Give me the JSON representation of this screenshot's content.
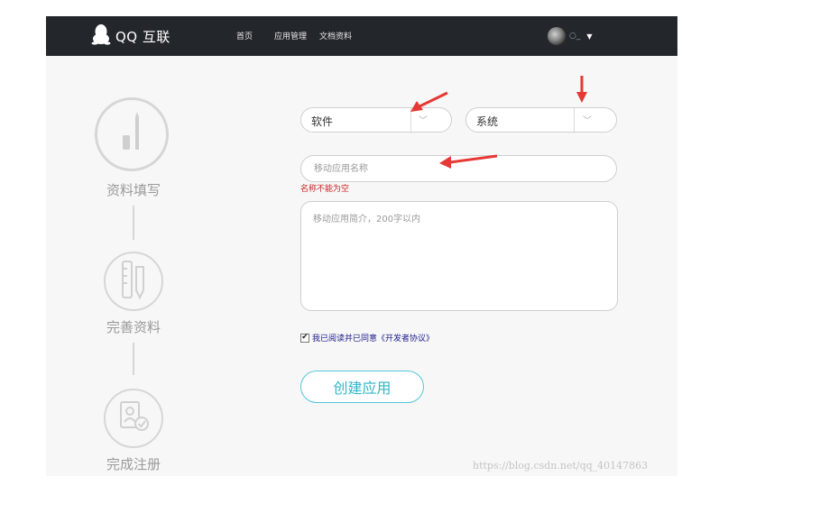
{
  "header": {
    "logo_text": "QQ 互联",
    "nav": [
      "首页",
      "应用管理",
      "文档资料"
    ],
    "username": "○_"
  },
  "steps": [
    {
      "label": "资料填写",
      "icon": "pen-icon"
    },
    {
      "label": "完善资料",
      "icon": "ruler-pencil-icon"
    },
    {
      "label": "完成注册",
      "icon": "document-check-icon"
    }
  ],
  "form": {
    "category_select": "软件",
    "platform_select": "系统",
    "name_placeholder": "移动应用名称",
    "name_error": "名称不能为空",
    "desc_placeholder": "移动应用简介，200字以内",
    "agreement_text": "我已阅读并已同意《开发者协议》",
    "agreement_checked": true,
    "create_button": "创建应用"
  },
  "watermark": "https://blog.csdn.net/qq_40147863",
  "colors": {
    "header_bg": "#23272c",
    "accent": "#2fb6cc",
    "error": "#cc2222",
    "annotation_arrow": "#e53935"
  }
}
